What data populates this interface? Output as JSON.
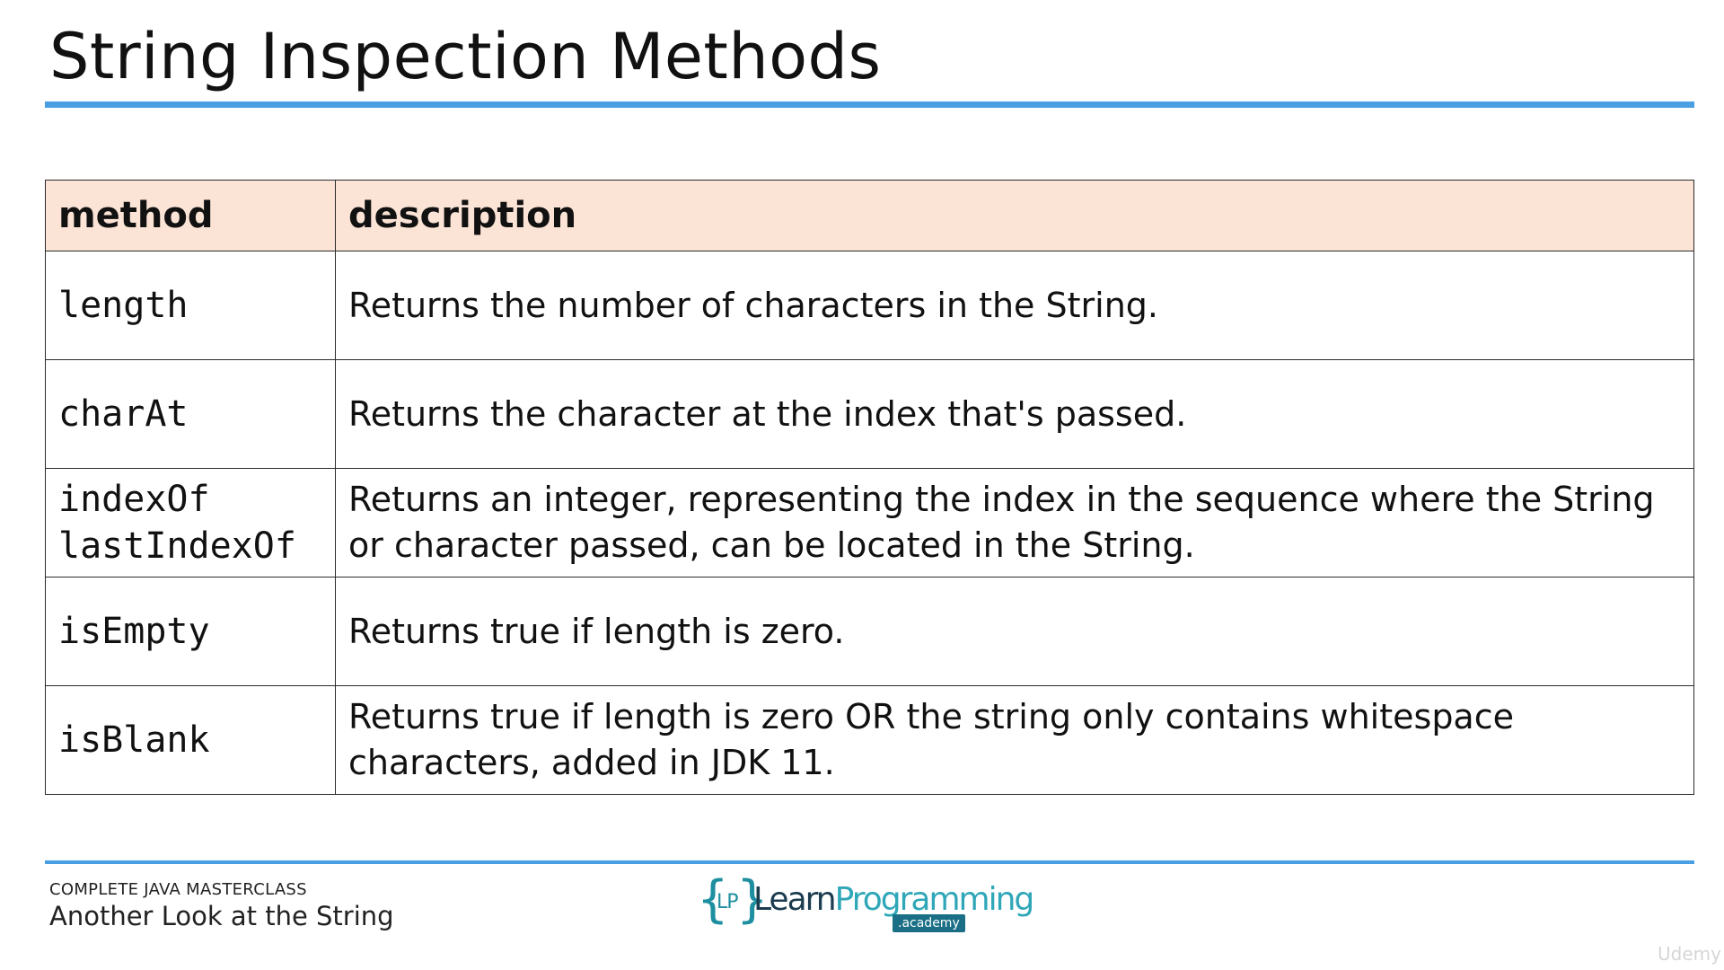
{
  "slide": {
    "title": "String Inspection Methods"
  },
  "table": {
    "headers": {
      "method": "method",
      "description": "description"
    },
    "rows": [
      {
        "method": "length",
        "description": "Returns the number of characters in the String."
      },
      {
        "method": "charAt",
        "description": "Returns the character at the index that's passed."
      },
      {
        "method": "indexOf\nlastIndexOf",
        "description": "Returns an integer, representing the index in the sequence where the String or character passed, can be located in the String."
      },
      {
        "method": "isEmpty",
        "description": "Returns true if length is zero."
      },
      {
        "method": "isBlank",
        "description": "Returns true if length is zero OR the string only contains whitespace characters, added in JDK 11."
      }
    ]
  },
  "footer": {
    "course": "COMPLETE JAVA MASTERCLASS",
    "lecture": "Another Look at the String",
    "logo": {
      "mark": "LP",
      "word1": "Learn",
      "word2": "Programming",
      "sub": ".academy"
    },
    "watermark": "Udemy"
  },
  "colors": {
    "accent_rule": "#4a9fe3",
    "header_fill": "#fbe3d6",
    "logo_teal": "#1e8fa0"
  }
}
